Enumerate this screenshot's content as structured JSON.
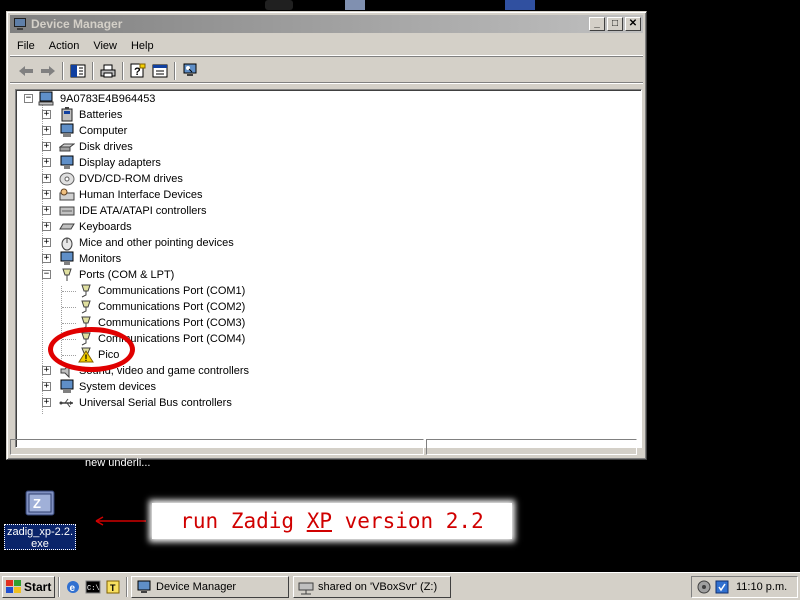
{
  "window": {
    "title": "Device Manager",
    "min_label": "_",
    "max_label": "□",
    "close_label": "✕"
  },
  "menu": [
    "File",
    "Action",
    "View",
    "Help"
  ],
  "tree": {
    "root": "9A0783E4B964453",
    "categories": [
      "Batteries",
      "Computer",
      "Disk drives",
      "Display adapters",
      "DVD/CD-ROM drives",
      "Human Interface Devices",
      "IDE ATA/ATAPI controllers",
      "Keyboards",
      "Mice and other pointing devices",
      "Monitors",
      "Ports (COM & LPT)"
    ],
    "ports": [
      "Communications Port (COM1)",
      "Communications Port (COM2)",
      "Communications Port (COM3)",
      "Communications Port (COM4)",
      "Pico"
    ],
    "after": [
      "Sound, video and game controllers",
      "System devices",
      "Universal Serial Bus controllers"
    ],
    "expand_collapsed": "+",
    "expand_open": "−"
  },
  "desktop": {
    "partial_label": "new underli...",
    "zadig_label_line1": "zadig_xp-2.2.",
    "zadig_label_line2": "exe",
    "annotation_pre": "run Zadig ",
    "annotation_ul": "XP",
    "annotation_post": " version 2.2"
  },
  "taskbar": {
    "start": "Start",
    "tasks": [
      "Device Manager",
      "shared on 'VBoxSvr' (Z:)"
    ],
    "clock": "11:10 p.m."
  },
  "colors": {
    "warning": "#f4d000",
    "annotation": "#d00000",
    "selection": "#0a246a"
  }
}
